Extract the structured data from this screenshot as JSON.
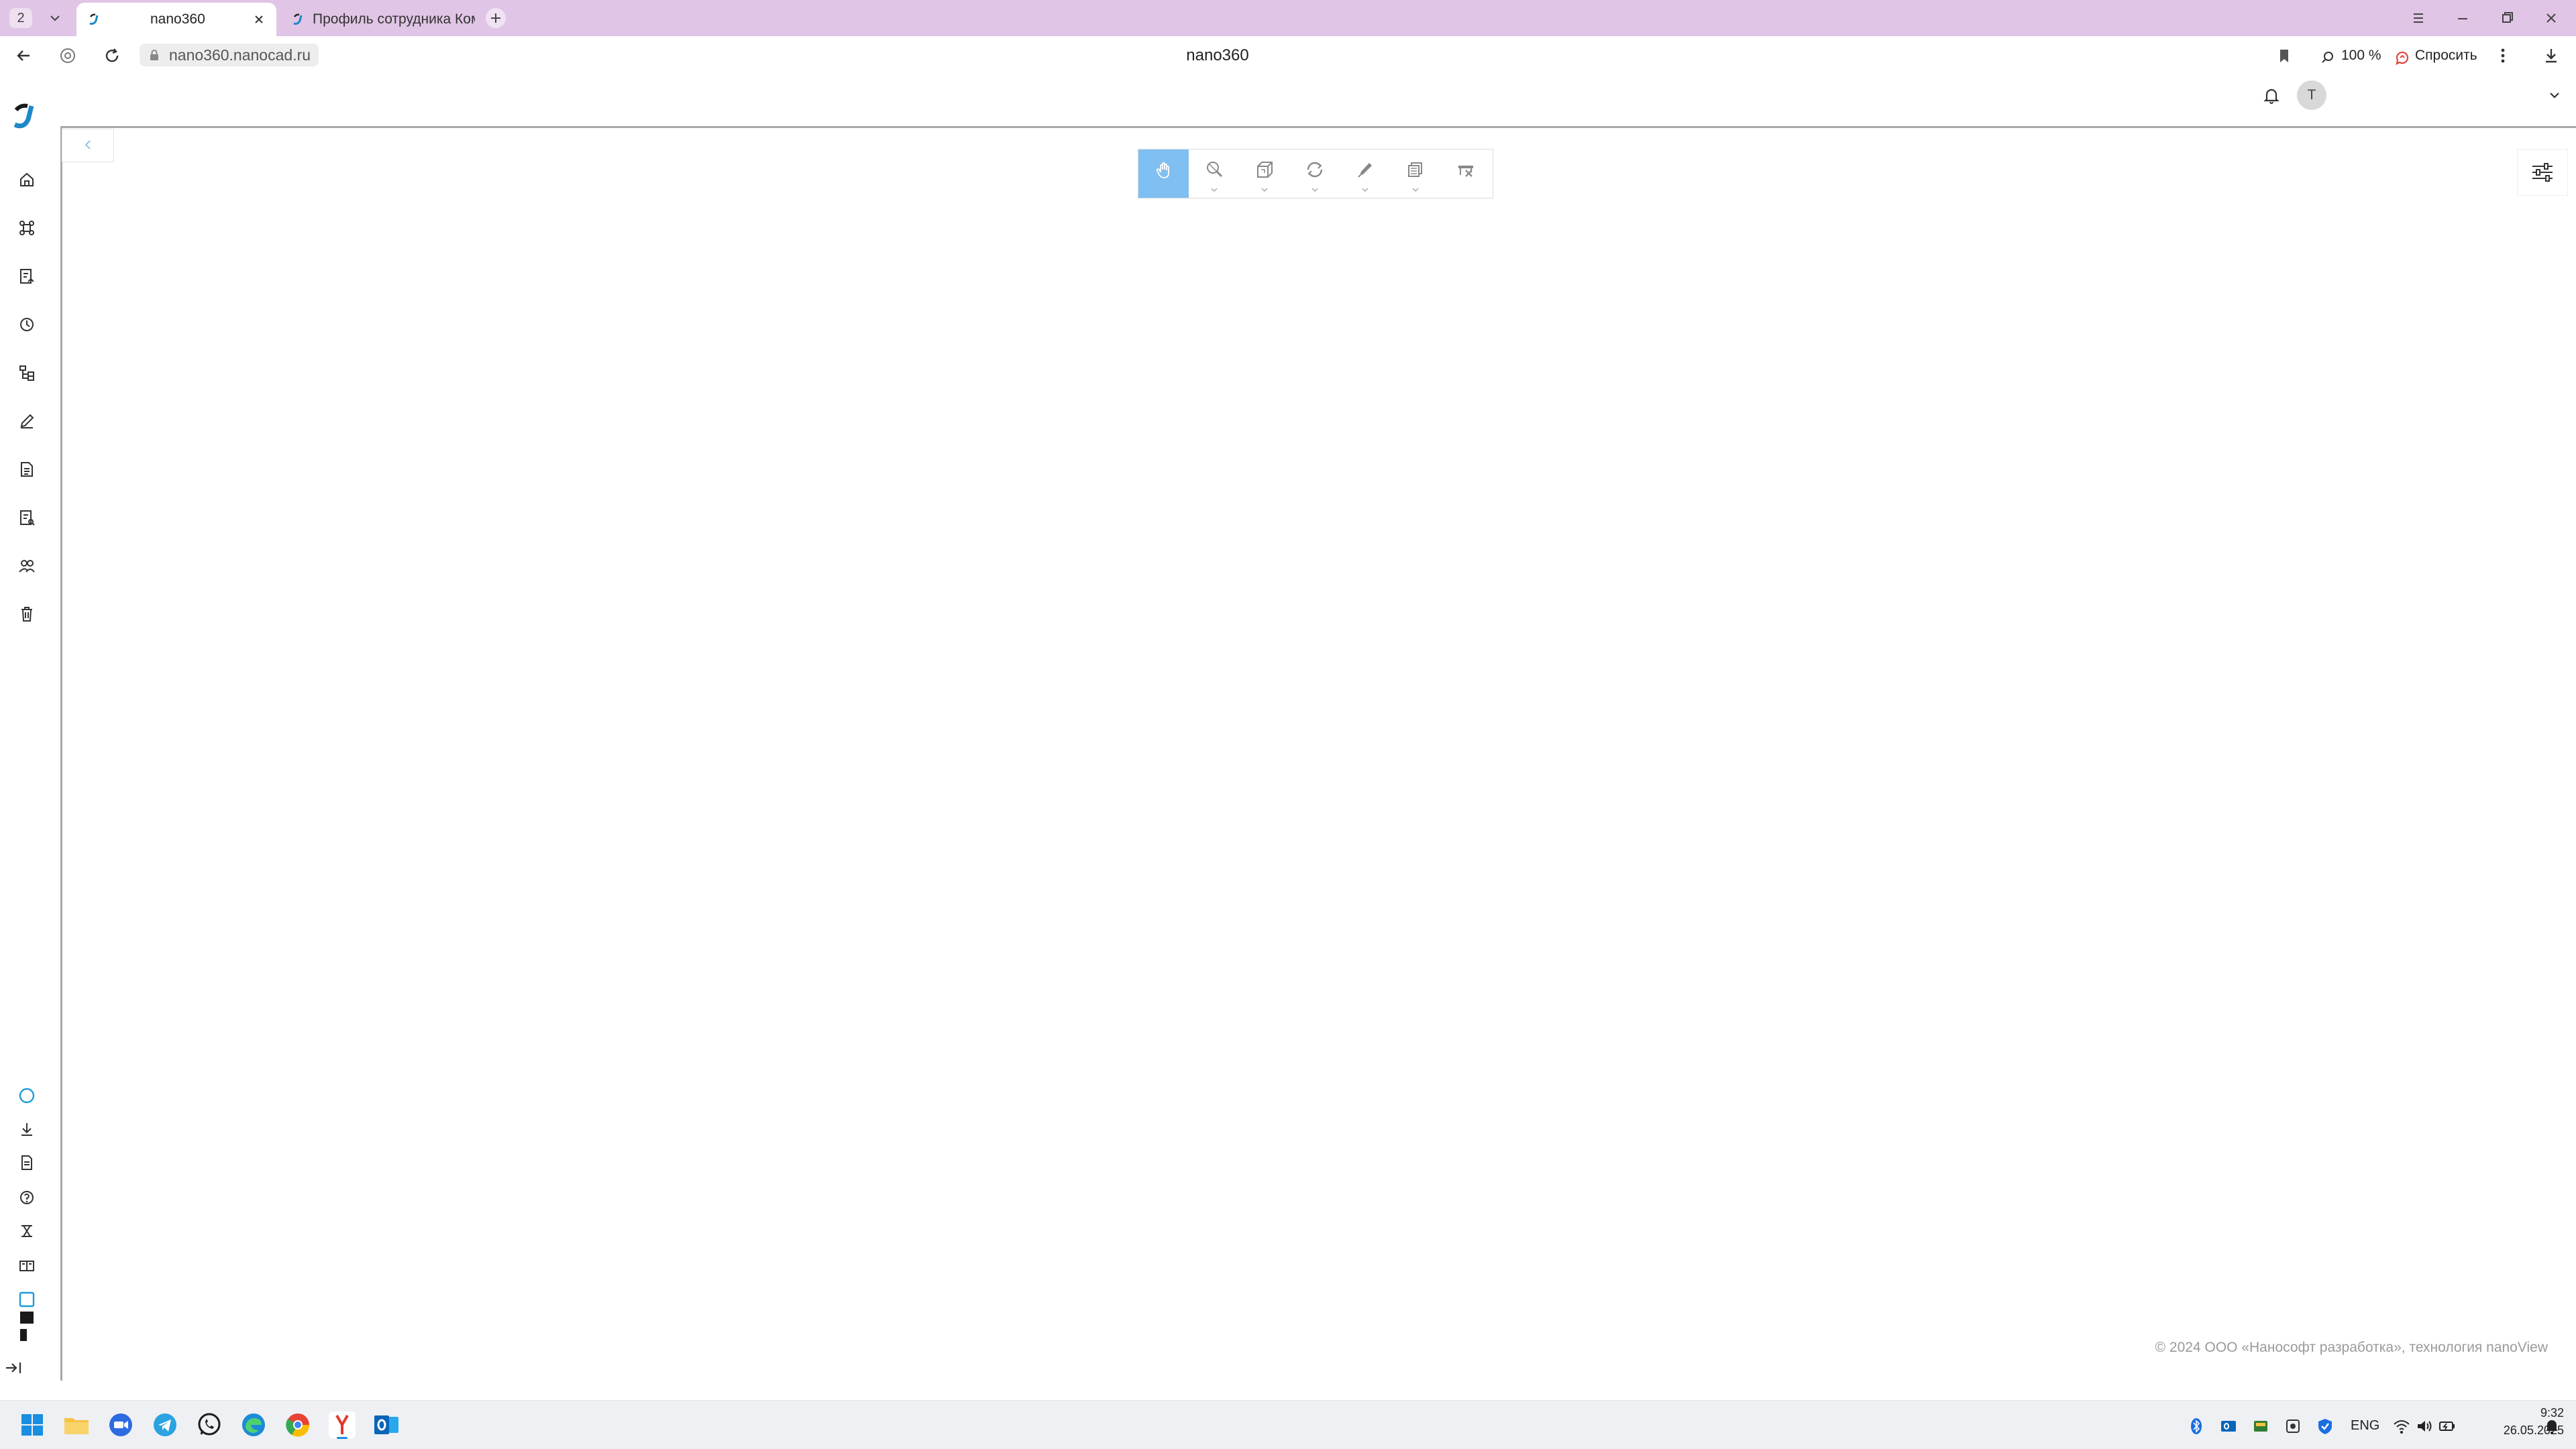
{
  "browser": {
    "tab_count": "2",
    "tabs": [
      {
        "title": "nano360",
        "active": true
      },
      {
        "title": "Профиль сотрудника Ком",
        "active": false
      }
    ],
    "url": "nano360.nanocad.ru",
    "page_title": "nano360",
    "zoom_label": "100 %",
    "ask_label": "Спросить"
  },
  "app": {
    "header": {
      "avatar_initial": "T"
    },
    "sidebar": {
      "top_items": [
        "home-icon",
        "projects-icon",
        "tasks-icon",
        "history-icon",
        "structure-icon",
        "edit-icon",
        "document-icon",
        "review-icon",
        "users-icon",
        "trash-icon"
      ],
      "bottom_items": [
        "status-circle-icon",
        "download-icon",
        "file-icon",
        "help-icon",
        "tools-icon",
        "book-icon",
        "theme-icon",
        "expand-sidebar-icon"
      ]
    },
    "viewer": {
      "toolbar": [
        {
          "name": "pan-tool",
          "icon": "hand-icon",
          "active": true,
          "dropdown": false
        },
        {
          "name": "zoom-tool",
          "icon": "zoom-icon",
          "active": false,
          "dropdown": true
        },
        {
          "name": "view-cube-tool",
          "icon": "cube-icon",
          "active": false,
          "dropdown": true
        },
        {
          "name": "orbit-tool",
          "icon": "orbit-icon",
          "active": false,
          "dropdown": true
        },
        {
          "name": "markup-tool",
          "icon": "pen-icon",
          "active": false,
          "dropdown": true
        },
        {
          "name": "layers-tool",
          "icon": "layers-icon",
          "active": false,
          "dropdown": true
        },
        {
          "name": "section-tool",
          "icon": "section-icon",
          "active": false,
          "dropdown": false
        }
      ],
      "copyright": "© 2024 ООО «Нанософт разработка», технология nanoView"
    }
  },
  "taskbar": {
    "lang": "ENG",
    "time": "9:32",
    "date": "26.05.2025"
  },
  "colors": {
    "tabstrip": "#e0c5e6",
    "active_tool": "#7fbff1",
    "accent": "#1e88c8"
  }
}
